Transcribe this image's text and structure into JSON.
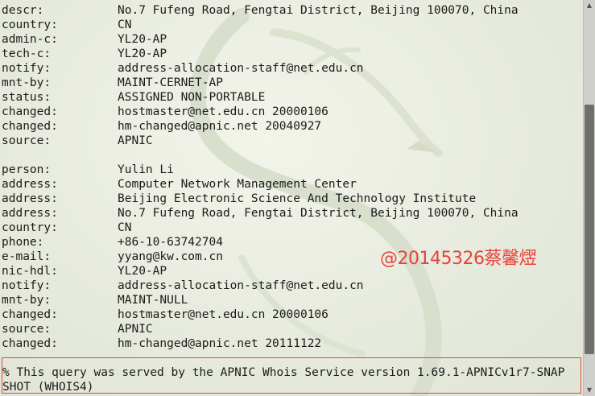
{
  "records": [
    {
      "key": "descr:",
      "value": "No.7 Fufeng Road, Fengtai District, Beijing 100070, China"
    },
    {
      "key": "country:",
      "value": "CN"
    },
    {
      "key": "admin-c:",
      "value": "YL20-AP"
    },
    {
      "key": "tech-c:",
      "value": "YL20-AP"
    },
    {
      "key": "notify:",
      "value": "address-allocation-staff@net.edu.cn"
    },
    {
      "key": "mnt-by:",
      "value": "MAINT-CERNET-AP"
    },
    {
      "key": "status:",
      "value": "ASSIGNED NON-PORTABLE"
    },
    {
      "key": "changed:",
      "value": "hostmaster@net.edu.cn 20000106"
    },
    {
      "key": "changed:",
      "value": "hm-changed@apnic.net 20040927"
    },
    {
      "key": "source:",
      "value": "APNIC"
    },
    {
      "key": "",
      "value": ""
    },
    {
      "key": "person:",
      "value": "Yulin Li"
    },
    {
      "key": "address:",
      "value": "Computer Network Management Center"
    },
    {
      "key": "address:",
      "value": "Beijing Electronic Science And Technology Institute"
    },
    {
      "key": "address:",
      "value": "No.7 Fufeng Road, Fengtai District, Beijing 100070, China"
    },
    {
      "key": "country:",
      "value": "CN"
    },
    {
      "key": "phone:",
      "value": "+86-10-63742704"
    },
    {
      "key": "e-mail:",
      "value": "yyang@kw.com.cn"
    },
    {
      "key": "nic-hdl:",
      "value": "YL20-AP"
    },
    {
      "key": "notify:",
      "value": "address-allocation-staff@net.edu.cn"
    },
    {
      "key": "mnt-by:",
      "value": "MAINT-NULL"
    },
    {
      "key": "changed:",
      "value": "hostmaster@net.edu.cn 20000106"
    },
    {
      "key": "source:",
      "value": "APNIC"
    },
    {
      "key": "changed:",
      "value": "hm-changed@apnic.net 20111122"
    }
  ],
  "footer": {
    "line1": "% This query was served by the APNIC Whois Service version 1.69.1-APNICv1r7-SNAP",
    "line2": "SHOT (WHOIS4)"
  },
  "watermark": "@20145326蔡馨熤",
  "colors": {
    "text": "#1b1b1b",
    "watermark": "#e8423b",
    "highlight_border": "#e24a3d"
  },
  "icons": {
    "background": "kali-dragon-icon"
  }
}
